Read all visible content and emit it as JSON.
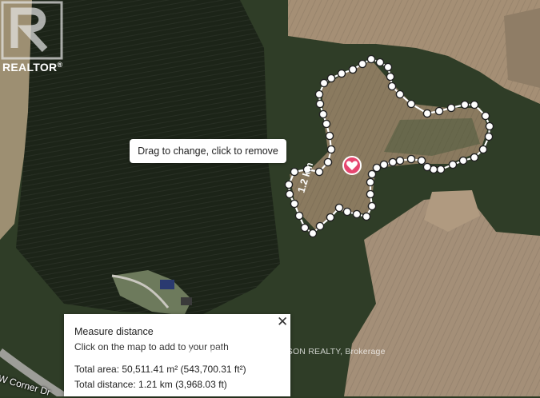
{
  "map": {
    "tooltip": "Drag to change, click to remove",
    "segment_label": "1.2 km",
    "road_label": "W Corner Dr",
    "watermark": "R..HARBINAGE SANDERSON REALTY, Brokerage",
    "marker_icon": "heart-icon",
    "path_color": "#ffffff"
  },
  "logo": {
    "brand": "REALTOR",
    "registered": "®"
  },
  "measure_panel": {
    "title": "Measure distance",
    "hint": "Click on the map to add to your path",
    "total_area": "Total area: 50,511.41 m² (543,700.31 ft²)",
    "total_distance": "Total distance: 1.21 km (3,968.03 ft)",
    "close_icon": "close-icon"
  }
}
